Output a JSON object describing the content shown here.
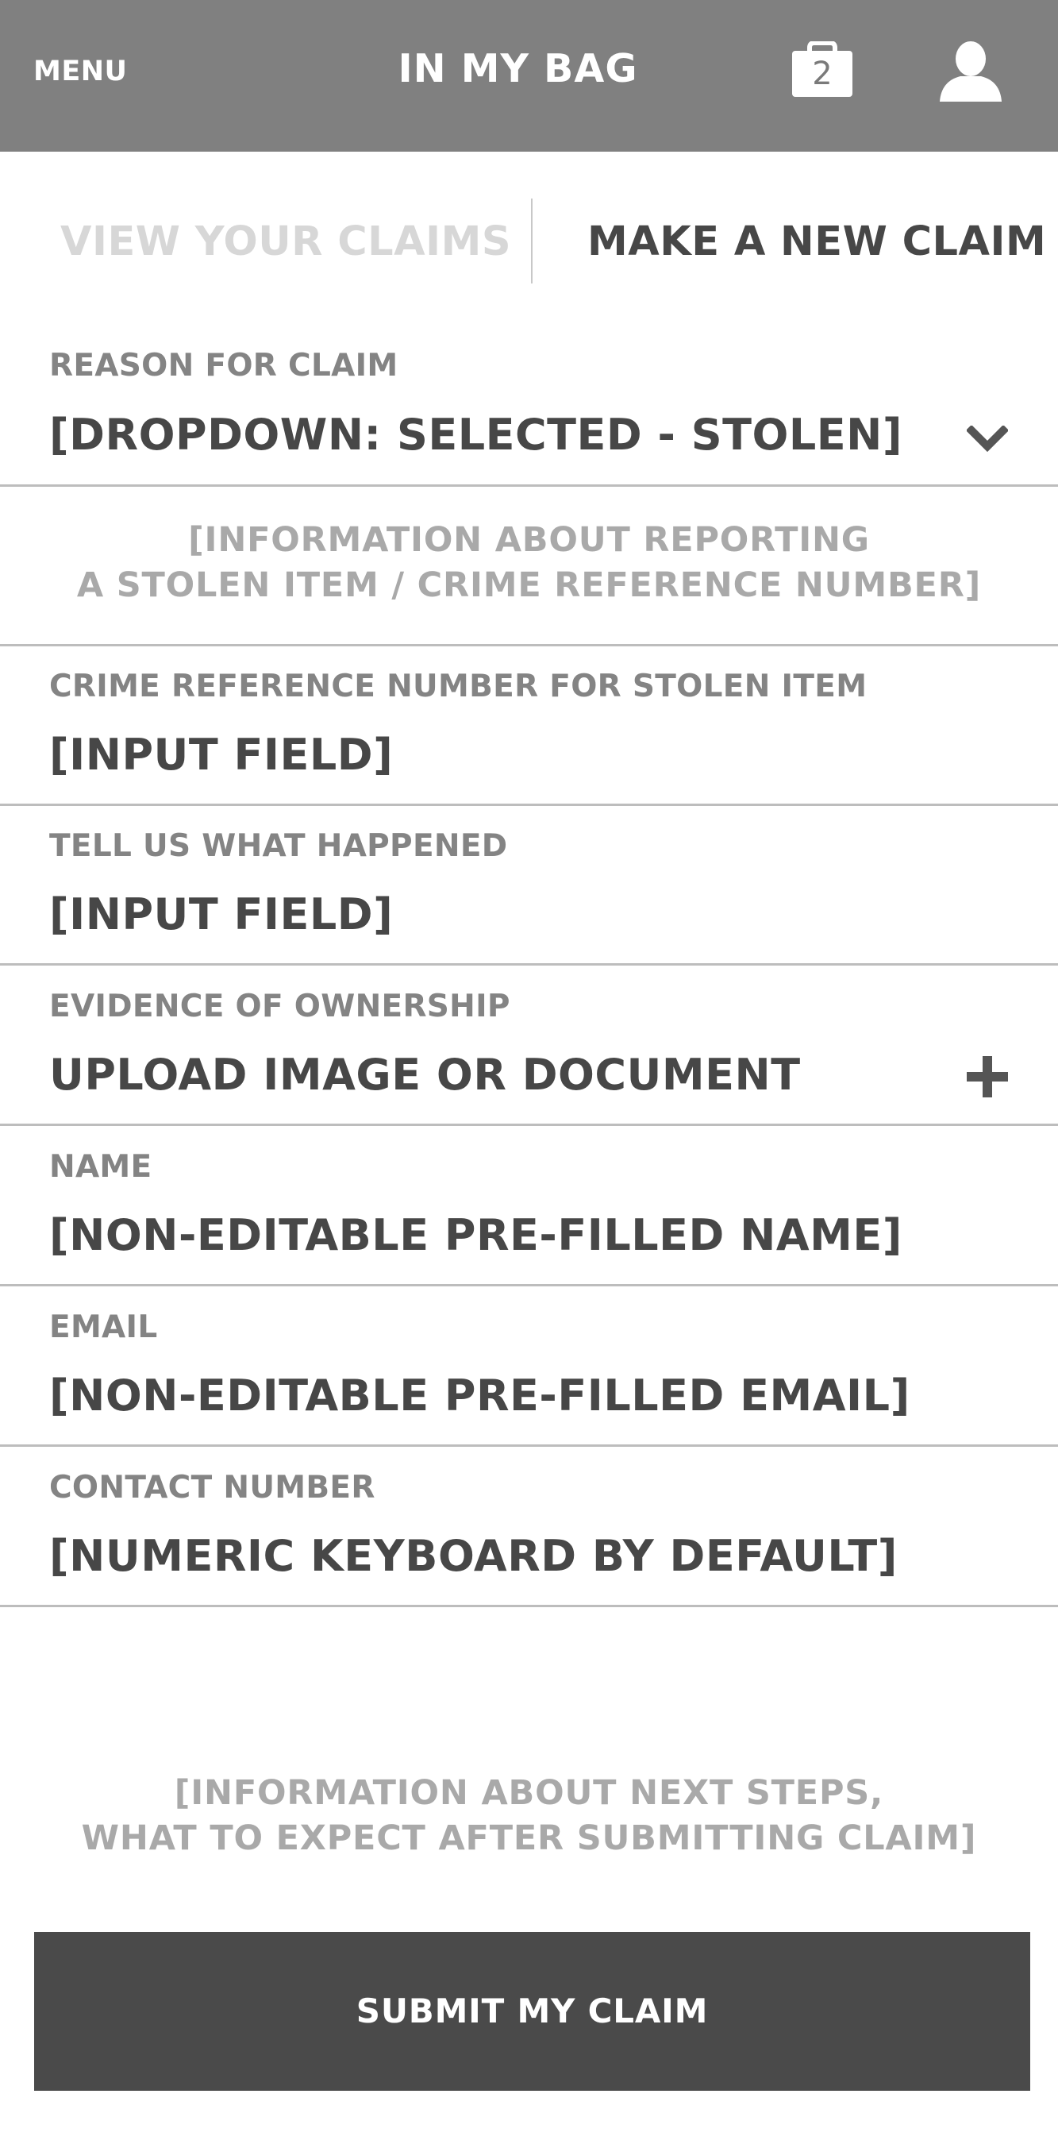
{
  "header": {
    "menu_label": "MENU",
    "title": "IN MY BAG",
    "bag_icon": "shopping-bag-icon",
    "bag_count": "2",
    "user_icon": "user-icon"
  },
  "tabs": [
    {
      "label": "VIEW YOUR CLAIMS",
      "active": false
    },
    {
      "label": "MAKE A NEW CLAIM",
      "active": true
    }
  ],
  "form": {
    "reason": {
      "label": "REASON FOR CLAIM",
      "value": "[DROPDOWN: SELECTED - STOLEN]",
      "icon": "chevron-down-icon"
    },
    "stolen_info": {
      "line1": "[INFORMATION ABOUT REPORTING",
      "line2": "A STOLEN ITEM / CRIME REFERENCE NUMBER]"
    },
    "crime_ref": {
      "label": "CRIME REFERENCE NUMBER FOR STOLEN ITEM",
      "value": "[INPUT FIELD]"
    },
    "what_happened": {
      "label": "TELL US WHAT HAPPENED",
      "value": "[INPUT FIELD]"
    },
    "evidence": {
      "label": "EVIDENCE OF OWNERSHIP",
      "value": "UPLOAD IMAGE OR DOCUMENT",
      "icon": "plus-icon"
    },
    "name": {
      "label": "NAME",
      "value": "[NON-EDITABLE PRE-FILLED NAME]"
    },
    "email": {
      "label": "EMAIL",
      "value": "[NON-EDITABLE PRE-FILLED EMAIL]"
    },
    "contact": {
      "label": "CONTACT NUMBER",
      "value": "[NUMERIC KEYBOARD BY DEFAULT]"
    }
  },
  "next_steps": {
    "line1": "[INFORMATION ABOUT NEXT STEPS,",
    "line2": "WHAT TO EXPECT AFTER SUBMITTING CLAIM]"
  },
  "submit_label": "SUBMIT MY CLAIM",
  "colors": {
    "header_bg": "#808080",
    "submit_bg": "#4a4a4a",
    "label_text": "#848484",
    "value_text": "#474747",
    "info_text": "#a9a9a9",
    "inactive_tab": "#d7d7d7"
  }
}
